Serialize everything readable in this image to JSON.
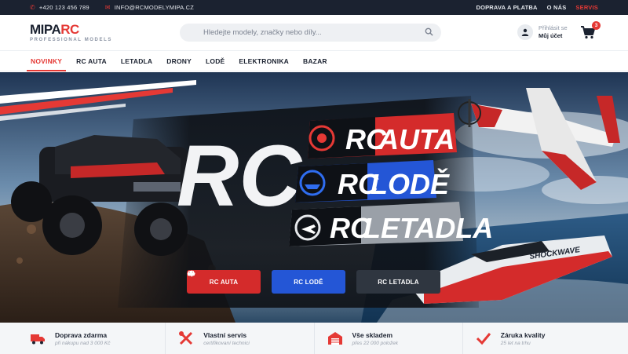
{
  "topbar": {
    "phone": "+420 123 456 789",
    "email": "INFO@RCMODELYMIPA.CZ",
    "links": [
      "DOPRAVA A PLATBA",
      "O NÁS",
      "SERVIS"
    ]
  },
  "header": {
    "logo_brand_a": "MIPA",
    "logo_brand_b": "RC",
    "logo_tagline": "PROFESSIONAL MODELS",
    "search_placeholder": "Hledejte modely, značky nebo díly...",
    "account_line1": "Přihlásit se",
    "account_line2": "Můj účet",
    "cart_count": "3"
  },
  "nav": {
    "items": [
      "NOVINKY",
      "RC AUTA",
      "LETADLA",
      "DRONY",
      "LODĚ",
      "ELEKTRONIKA",
      "BAZAR"
    ],
    "active_index": 0
  },
  "hero": {
    "big_title": "RC",
    "lines": [
      {
        "prefix": "RC",
        "word": "AUTA",
        "icon": "wheel-icon"
      },
      {
        "prefix": "RC",
        "word": "LODĚ",
        "icon": "boat-icon"
      },
      {
        "prefix": "RC",
        "word": "LETADLA",
        "icon": "plane-icon"
      }
    ],
    "boat_name": "SHOCKWAVE",
    "buttons": [
      {
        "label": "RC AUTA",
        "icon": "car-icon",
        "color": "#d42b2b"
      },
      {
        "label": "RC LODĚ",
        "icon": "boat-icon",
        "color": "#2456d6"
      },
      {
        "label": "RC LETADLA",
        "icon": "plane-icon",
        "color": "#2f3640"
      }
    ]
  },
  "features": [
    {
      "title": "Doprava zdarma",
      "subtitle": "při nákupu nad 3 000 Kč",
      "icon": "truck-icon"
    },
    {
      "title": "Vlastní servis",
      "subtitle": "certifikovaní technici",
      "icon": "tools-icon"
    },
    {
      "title": "Vše skladem",
      "subtitle": "přes 22 000 položek",
      "icon": "warehouse-icon"
    },
    {
      "title": "Záruka kvality",
      "subtitle": "25 let na trhu",
      "icon": "check-icon"
    }
  ],
  "colors": {
    "accent": "#e53935",
    "dark": "#1b2230",
    "blue": "#2456d6"
  }
}
